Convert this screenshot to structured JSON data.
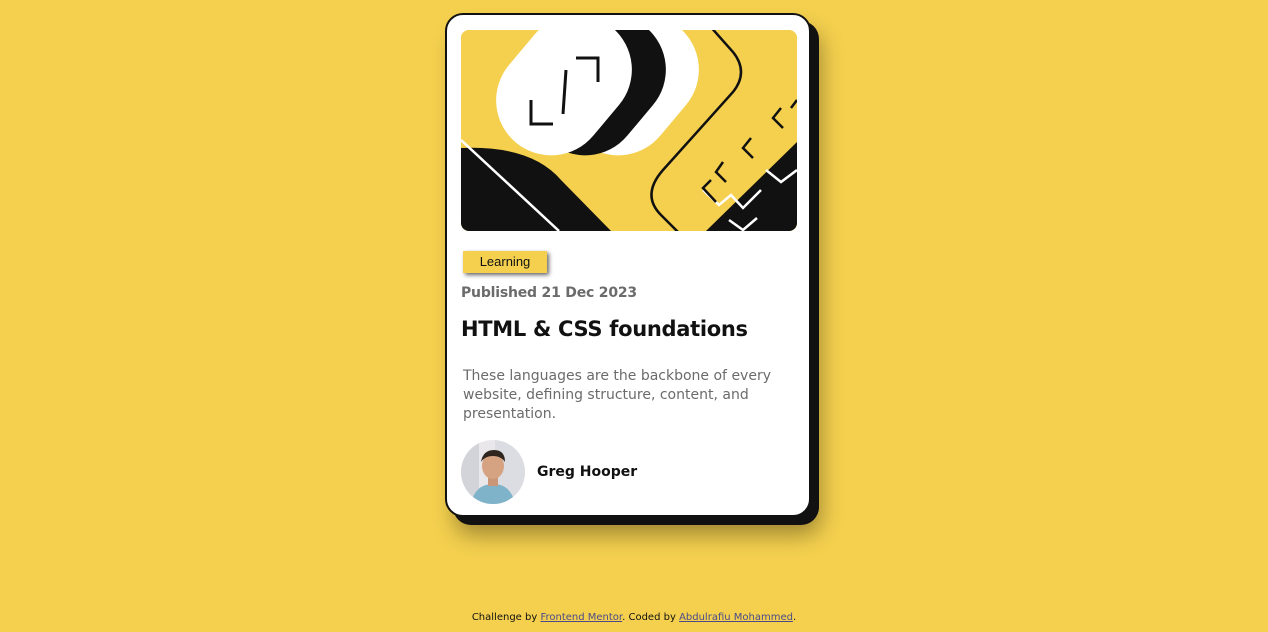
{
  "colors": {
    "background": "#f4d04e",
    "card": "#ffffff",
    "ink": "#111111",
    "muted": "#6b6b6b",
    "link": "#4a4a8a"
  },
  "card": {
    "hero_image": "illustration-article",
    "tag": "Learning",
    "published": "Published 21 Dec 2023",
    "title": "HTML & CSS foundations",
    "description": "These languages are the backbone of every website, defining structure, content, and presentation.",
    "author": {
      "avatar": "image-avatar",
      "name": "Greg Hooper"
    }
  },
  "attribution": {
    "prefix": "Challenge by ",
    "challenge_link": "Frontend Mentor",
    "middle": ". Coded by ",
    "author_link": "Abdulrafiu Mohammed",
    "suffix": "."
  }
}
